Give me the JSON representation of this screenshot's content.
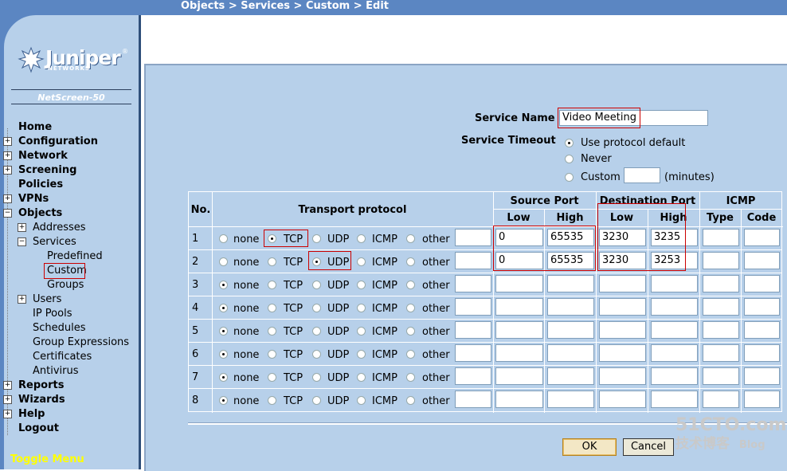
{
  "breadcrumb": "Objects > Services > Custom > Edit",
  "logo": {
    "word": "Juniper",
    "sub": "NETWORKS",
    "mark": "registered"
  },
  "device": "NetScreen-50",
  "nav": {
    "home": "Home",
    "configuration": "Configuration",
    "network": "Network",
    "screening": "Screening",
    "policies": "Policies",
    "vpns": "VPNs",
    "objects": "Objects",
    "addresses": "Addresses",
    "services": "Services",
    "predefined": "Predefined",
    "custom": "Custom",
    "groups": "Groups",
    "users": "Users",
    "ip_pools": "IP Pools",
    "schedules": "Schedules",
    "group_expressions": "Group Expressions",
    "certificates": "Certificates",
    "antivirus": "Antivirus",
    "reports": "Reports",
    "wizards": "Wizards",
    "help": "Help",
    "logout": "Logout",
    "toggle": "Toggle Menu"
  },
  "form": {
    "service_name_label": "Service Name",
    "service_name_value": "Video Meeting",
    "timeout_label": "Service Timeout",
    "timeout_options": [
      "Use protocol default",
      "Never",
      "Custom"
    ],
    "timeout_selected": "Use protocol default",
    "custom_value": "",
    "minutes": "(minutes)"
  },
  "table": {
    "headers": {
      "no": "No.",
      "transport": "Transport protocol",
      "source": "Source Port",
      "dest": "Destination Port",
      "icmp": "ICMP",
      "low": "Low",
      "high": "High",
      "type": "Type",
      "code": "Code"
    },
    "protocols": [
      "none",
      "TCP",
      "UDP",
      "ICMP",
      "other"
    ],
    "rows": [
      {
        "no": "1",
        "protocol": "TCP",
        "other": "",
        "src_low": "0",
        "src_high": "65535",
        "dst_low": "3230",
        "dst_high": "3235",
        "type": "",
        "code": ""
      },
      {
        "no": "2",
        "protocol": "UDP",
        "other": "",
        "src_low": "0",
        "src_high": "65535",
        "dst_low": "3230",
        "dst_high": "3253",
        "type": "",
        "code": ""
      },
      {
        "no": "3",
        "protocol": "none",
        "other": "",
        "src_low": "",
        "src_high": "",
        "dst_low": "",
        "dst_high": "",
        "type": "",
        "code": ""
      },
      {
        "no": "4",
        "protocol": "none",
        "other": "",
        "src_low": "",
        "src_high": "",
        "dst_low": "",
        "dst_high": "",
        "type": "",
        "code": ""
      },
      {
        "no": "5",
        "protocol": "none",
        "other": "",
        "src_low": "",
        "src_high": "",
        "dst_low": "",
        "dst_high": "",
        "type": "",
        "code": ""
      },
      {
        "no": "6",
        "protocol": "none",
        "other": "",
        "src_low": "",
        "src_high": "",
        "dst_low": "",
        "dst_high": "",
        "type": "",
        "code": ""
      },
      {
        "no": "7",
        "protocol": "none",
        "other": "",
        "src_low": "",
        "src_high": "",
        "dst_low": "",
        "dst_high": "",
        "type": "",
        "code": ""
      },
      {
        "no": "8",
        "protocol": "none",
        "other": "",
        "src_low": "",
        "src_high": "",
        "dst_low": "",
        "dst_high": "",
        "type": "",
        "code": ""
      }
    ]
  },
  "buttons": {
    "ok": "OK",
    "cancel": "Cancel"
  },
  "watermark": {
    "site": "51CTO.com",
    "cn": "技术博客",
    "blog": "Blog"
  },
  "colors": {
    "band": "#5b86c2",
    "panel": "#b7d0ea",
    "highlight": "#cc0000",
    "toggle": "#ffff00"
  }
}
